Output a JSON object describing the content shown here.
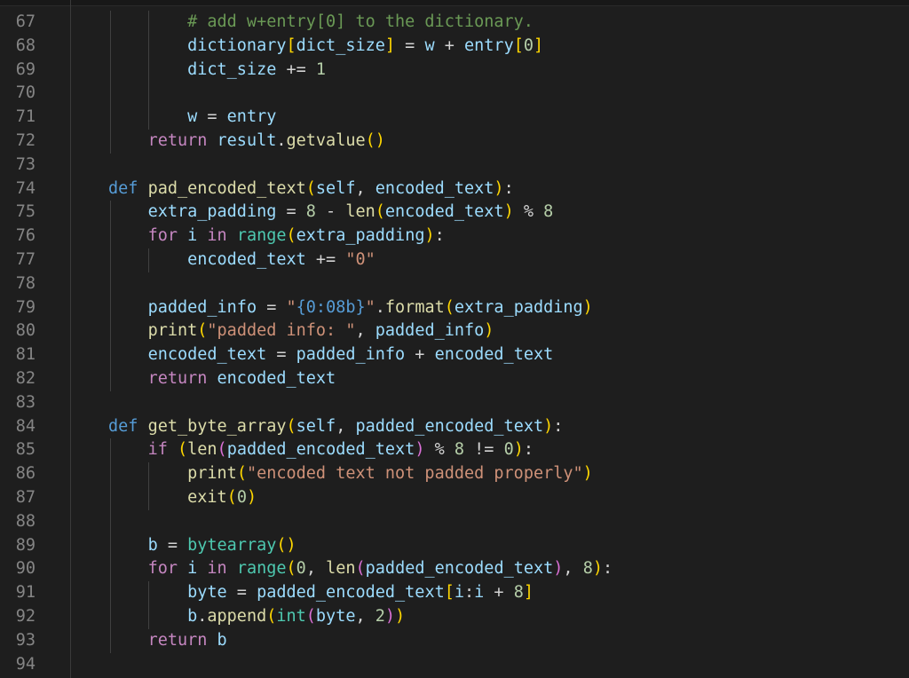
{
  "editor": {
    "lines": [
      {
        "num": "67",
        "tokens": [
          [
            "        ",
            ""
          ],
          [
            "# add w+entry[0] to the dictionary.",
            "cm"
          ]
        ]
      },
      {
        "num": "68",
        "tokens": [
          [
            "        ",
            ""
          ],
          [
            "dictionary",
            "var"
          ],
          [
            "[",
            "b1"
          ],
          [
            "dict_size",
            "var"
          ],
          [
            "]",
            "b1"
          ],
          [
            " = ",
            "op"
          ],
          [
            "w",
            "var"
          ],
          [
            " + ",
            "op"
          ],
          [
            "entry",
            "var"
          ],
          [
            "[",
            "b1"
          ],
          [
            "0",
            "num"
          ],
          [
            "]",
            "b1"
          ]
        ]
      },
      {
        "num": "69",
        "tokens": [
          [
            "        ",
            ""
          ],
          [
            "dict_size",
            "var"
          ],
          [
            " += ",
            "op"
          ],
          [
            "1",
            "num"
          ]
        ]
      },
      {
        "num": "70",
        "tokens": []
      },
      {
        "num": "71",
        "tokens": [
          [
            "        ",
            ""
          ],
          [
            "w",
            "var"
          ],
          [
            " = ",
            "op"
          ],
          [
            "entry",
            "var"
          ]
        ]
      },
      {
        "num": "72",
        "tokens": [
          [
            "    ",
            ""
          ],
          [
            "return",
            "kw"
          ],
          [
            " ",
            ""
          ],
          [
            "result",
            "var"
          ],
          [
            ".",
            "op"
          ],
          [
            "getvalue",
            "fn"
          ],
          [
            "()",
            "b1"
          ]
        ]
      },
      {
        "num": "73",
        "tokens": []
      },
      {
        "num": "74",
        "tokens": [
          [
            "def",
            "def"
          ],
          [
            " ",
            ""
          ],
          [
            "pad_encoded_text",
            "fn"
          ],
          [
            "(",
            "b1"
          ],
          [
            "self",
            "self"
          ],
          [
            ", ",
            "op"
          ],
          [
            "encoded_text",
            "var"
          ],
          [
            ")",
            "b1"
          ],
          [
            ":",
            "op"
          ]
        ]
      },
      {
        "num": "75",
        "tokens": [
          [
            "    ",
            ""
          ],
          [
            "extra_padding",
            "var"
          ],
          [
            " = ",
            "op"
          ],
          [
            "8",
            "num"
          ],
          [
            " - ",
            "op"
          ],
          [
            "len",
            "fn"
          ],
          [
            "(",
            "b1"
          ],
          [
            "encoded_text",
            "var"
          ],
          [
            ")",
            "b1"
          ],
          [
            " % ",
            "op"
          ],
          [
            "8",
            "num"
          ]
        ]
      },
      {
        "num": "76",
        "tokens": [
          [
            "    ",
            ""
          ],
          [
            "for",
            "kw"
          ],
          [
            " ",
            ""
          ],
          [
            "i",
            "var"
          ],
          [
            " ",
            ""
          ],
          [
            "in",
            "kw"
          ],
          [
            " ",
            ""
          ],
          [
            "range",
            "bi"
          ],
          [
            "(",
            "b1"
          ],
          [
            "extra_padding",
            "var"
          ],
          [
            ")",
            "b1"
          ],
          [
            ":",
            "op"
          ]
        ]
      },
      {
        "num": "77",
        "tokens": [
          [
            "        ",
            ""
          ],
          [
            "encoded_text",
            "var"
          ],
          [
            " += ",
            "op"
          ],
          [
            "\"0\"",
            "str"
          ]
        ]
      },
      {
        "num": "78",
        "tokens": []
      },
      {
        "num": "79",
        "tokens": [
          [
            "    ",
            ""
          ],
          [
            "padded_info",
            "var"
          ],
          [
            " = ",
            "op"
          ],
          [
            "\"",
            "str"
          ],
          [
            "{0:08b}",
            "def"
          ],
          [
            "\"",
            "str"
          ],
          [
            ".",
            "op"
          ],
          [
            "format",
            "fn"
          ],
          [
            "(",
            "b1"
          ],
          [
            "extra_padding",
            "var"
          ],
          [
            ")",
            "b1"
          ]
        ]
      },
      {
        "num": "80",
        "tokens": [
          [
            "    ",
            ""
          ],
          [
            "print",
            "fn"
          ],
          [
            "(",
            "b1"
          ],
          [
            "\"padded info: \"",
            "str"
          ],
          [
            ", ",
            "op"
          ],
          [
            "padded_info",
            "var"
          ],
          [
            ")",
            "b1"
          ]
        ]
      },
      {
        "num": "81",
        "tokens": [
          [
            "    ",
            ""
          ],
          [
            "encoded_text",
            "var"
          ],
          [
            " = ",
            "op"
          ],
          [
            "padded_info",
            "var"
          ],
          [
            " + ",
            "op"
          ],
          [
            "encoded_text",
            "var"
          ]
        ]
      },
      {
        "num": "82",
        "tokens": [
          [
            "    ",
            ""
          ],
          [
            "return",
            "kw"
          ],
          [
            " ",
            ""
          ],
          [
            "encoded_text",
            "var"
          ]
        ]
      },
      {
        "num": "83",
        "tokens": []
      },
      {
        "num": "84",
        "tokens": [
          [
            "def",
            "def"
          ],
          [
            " ",
            ""
          ],
          [
            "get_byte_array",
            "fn"
          ],
          [
            "(",
            "b1"
          ],
          [
            "self",
            "self"
          ],
          [
            ", ",
            "op"
          ],
          [
            "padded_encoded_text",
            "var"
          ],
          [
            ")",
            "b1"
          ],
          [
            ":",
            "op"
          ]
        ]
      },
      {
        "num": "85",
        "tokens": [
          [
            "    ",
            ""
          ],
          [
            "if",
            "kw"
          ],
          [
            " ",
            ""
          ],
          [
            "(",
            "b1"
          ],
          [
            "len",
            "fn"
          ],
          [
            "(",
            "b2"
          ],
          [
            "padded_encoded_text",
            "var"
          ],
          [
            ")",
            "b2"
          ],
          [
            " % ",
            "op"
          ],
          [
            "8",
            "num"
          ],
          [
            " != ",
            "op"
          ],
          [
            "0",
            "num"
          ],
          [
            ")",
            "b1"
          ],
          [
            ":",
            "op"
          ]
        ]
      },
      {
        "num": "86",
        "tokens": [
          [
            "        ",
            ""
          ],
          [
            "print",
            "fn"
          ],
          [
            "(",
            "b1"
          ],
          [
            "\"encoded text not padded properly\"",
            "str"
          ],
          [
            ")",
            "b1"
          ]
        ]
      },
      {
        "num": "87",
        "tokens": [
          [
            "        ",
            ""
          ],
          [
            "exit",
            "fn"
          ],
          [
            "(",
            "b1"
          ],
          [
            "0",
            "num"
          ],
          [
            ")",
            "b1"
          ]
        ]
      },
      {
        "num": "88",
        "tokens": []
      },
      {
        "num": "89",
        "tokens": [
          [
            "    ",
            ""
          ],
          [
            "b",
            "var"
          ],
          [
            " = ",
            "op"
          ],
          [
            "bytearray",
            "bi"
          ],
          [
            "()",
            "b1"
          ]
        ]
      },
      {
        "num": "90",
        "tokens": [
          [
            "    ",
            ""
          ],
          [
            "for",
            "kw"
          ],
          [
            " ",
            ""
          ],
          [
            "i",
            "var"
          ],
          [
            " ",
            ""
          ],
          [
            "in",
            "kw"
          ],
          [
            " ",
            ""
          ],
          [
            "range",
            "bi"
          ],
          [
            "(",
            "b1"
          ],
          [
            "0",
            "num"
          ],
          [
            ", ",
            "op"
          ],
          [
            "len",
            "fn"
          ],
          [
            "(",
            "b2"
          ],
          [
            "padded_encoded_text",
            "var"
          ],
          [
            ")",
            "b2"
          ],
          [
            ", ",
            "op"
          ],
          [
            "8",
            "num"
          ],
          [
            ")",
            "b1"
          ],
          [
            ":",
            "op"
          ]
        ]
      },
      {
        "num": "91",
        "tokens": [
          [
            "        ",
            ""
          ],
          [
            "byte",
            "var"
          ],
          [
            " = ",
            "op"
          ],
          [
            "padded_encoded_text",
            "var"
          ],
          [
            "[",
            "b1"
          ],
          [
            "i",
            "var"
          ],
          [
            ":",
            "op"
          ],
          [
            "i",
            "var"
          ],
          [
            " + ",
            "op"
          ],
          [
            "8",
            "num"
          ],
          [
            "]",
            "b1"
          ]
        ]
      },
      {
        "num": "92",
        "tokens": [
          [
            "        ",
            ""
          ],
          [
            "b",
            "var"
          ],
          [
            ".",
            "op"
          ],
          [
            "append",
            "fn"
          ],
          [
            "(",
            "b1"
          ],
          [
            "int",
            "bi"
          ],
          [
            "(",
            "b2"
          ],
          [
            "byte",
            "var"
          ],
          [
            ", ",
            "op"
          ],
          [
            "2",
            "num"
          ],
          [
            ")",
            "b2"
          ],
          [
            ")",
            "b1"
          ]
        ]
      },
      {
        "num": "93",
        "tokens": [
          [
            "    ",
            ""
          ],
          [
            "return",
            "kw"
          ],
          [
            " ",
            ""
          ],
          [
            "b",
            "var"
          ]
        ]
      },
      {
        "num": "94",
        "tokens": []
      }
    ]
  }
}
